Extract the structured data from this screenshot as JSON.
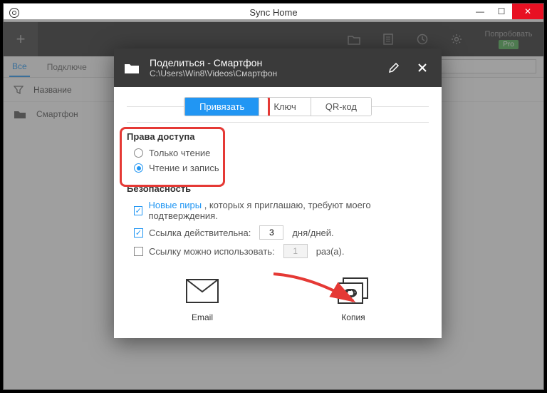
{
  "window": {
    "title": "Sync Home",
    "min": "—",
    "max": "☐",
    "close": "✕"
  },
  "toolbar": {
    "add": "+",
    "try_pro_label": "Попробовать",
    "pro_badge": "Pro"
  },
  "tabs": {
    "all": "Все",
    "connected": "Подключе"
  },
  "columns": {
    "name": "Название"
  },
  "rows": {
    "item0": "Смартфон"
  },
  "dialog": {
    "title": "Поделиться - Смартфон",
    "path": "C:\\Users\\Win8\\Videos\\Смартфон",
    "subtabs": {
      "link": "Привязать",
      "key": "Ключ",
      "qr": "QR-код"
    },
    "access": {
      "label": "Права доступа",
      "read_only": "Только чтение",
      "read_write": "Чтение и запись"
    },
    "security": {
      "label": "Безопасность",
      "new_peers_link": "Новые пиры",
      "new_peers_rest": " , которых я приглашаю, требуют моего подтверждения.",
      "link_valid_pre": "Ссылка действительна:",
      "link_valid_days": "3",
      "link_valid_post": "дня/дней.",
      "link_uses_pre": "Ссылку можно использовать:",
      "link_uses_val": "1",
      "link_uses_post": "раз(а)."
    },
    "share": {
      "email": "Email",
      "copy": "Копия"
    }
  }
}
